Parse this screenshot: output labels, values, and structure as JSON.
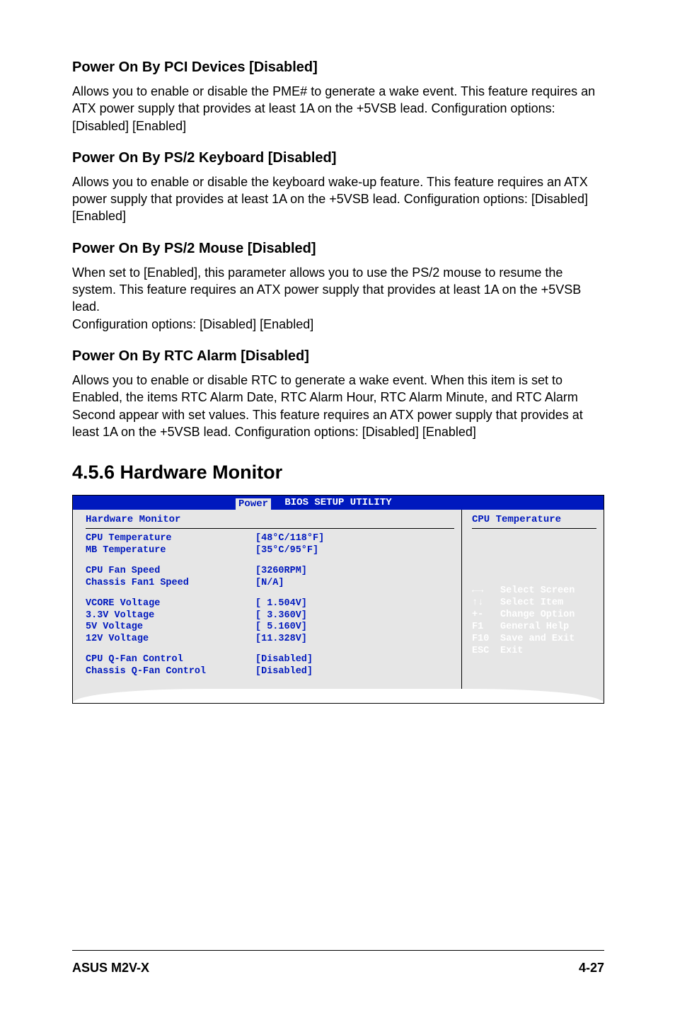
{
  "sections": {
    "pci": {
      "heading": "Power On By PCI Devices [Disabled]",
      "body": "Allows you to enable or disable the PME# to generate a wake event. This feature requires an ATX power supply that provides at least 1A on the +5VSB lead. Configuration options: [Disabled] [Enabled]"
    },
    "ps2kb": {
      "heading": "Power On By PS/2 Keyboard [Disabled]",
      "body": "Allows you to enable or disable the keyboard wake-up feature. This feature requires an ATX power supply that provides at least 1A on the +5VSB lead. Configuration options: [Disabled] [Enabled]"
    },
    "ps2mouse": {
      "heading": "Power On By PS/2 Mouse [Disabled]",
      "body": "When set to [Enabled], this parameter allows you to use the PS/2 mouse to resume the system. This feature requires an ATX power supply that provides at least 1A on the +5VSB lead.\nConfiguration options: [Disabled] [Enabled]"
    },
    "rtc": {
      "heading": "Power On By RTC Alarm [Disabled]",
      "body": "Allows you to enable or disable RTC to generate a wake event. When this item is set to Enabled, the items RTC Alarm Date, RTC Alarm Hour, RTC Alarm Minute, and RTC Alarm Second appear with set values. This feature requires an ATX power supply that provides at least 1A on the +5VSB lead. Configuration options: [Disabled] [Enabled]"
    }
  },
  "subsection_title": "4.5.6 Hardware Monitor",
  "bios": {
    "title": "BIOS SETUP UTILITY",
    "tab": "Power",
    "left_title": "Hardware Monitor",
    "right_title": "CPU Temperature",
    "groups": [
      [
        {
          "label": "CPU Temperature",
          "value": "[48°C/118°F]"
        },
        {
          "label": "MB Temperature",
          "value": "[35°C/95°F]"
        }
      ],
      [
        {
          "label": "CPU Fan Speed",
          "value": "[3260RPM]"
        },
        {
          "label": "Chassis Fan1 Speed",
          "value": "[N/A]"
        }
      ],
      [
        {
          "label": "VCORE Voltage",
          "value": "[ 1.504V]"
        },
        {
          "label": "3.3V Voltage",
          "value": "[ 3.360V]"
        },
        {
          "label": "5V Voltage",
          "value": "[ 5.160V]"
        },
        {
          "label": "12V Voltage",
          "value": "[11.328V]"
        }
      ],
      [
        {
          "label": "CPU Q-Fan Control",
          "value": "[Disabled]"
        },
        {
          "label": "Chassis Q-Fan Control",
          "value": "[Disabled]"
        }
      ]
    ],
    "help": [
      {
        "key": "←→",
        "label": "Select Screen"
      },
      {
        "key": "↑↓",
        "label": "Select Item"
      },
      {
        "key": "+-",
        "label": "Change Option"
      },
      {
        "key": "F1",
        "label": "General Help"
      },
      {
        "key": "F10",
        "label": "Save and Exit"
      },
      {
        "key": "ESC",
        "label": "Exit"
      }
    ]
  },
  "footer": {
    "left": "ASUS M2V-X",
    "right": "4-27"
  }
}
